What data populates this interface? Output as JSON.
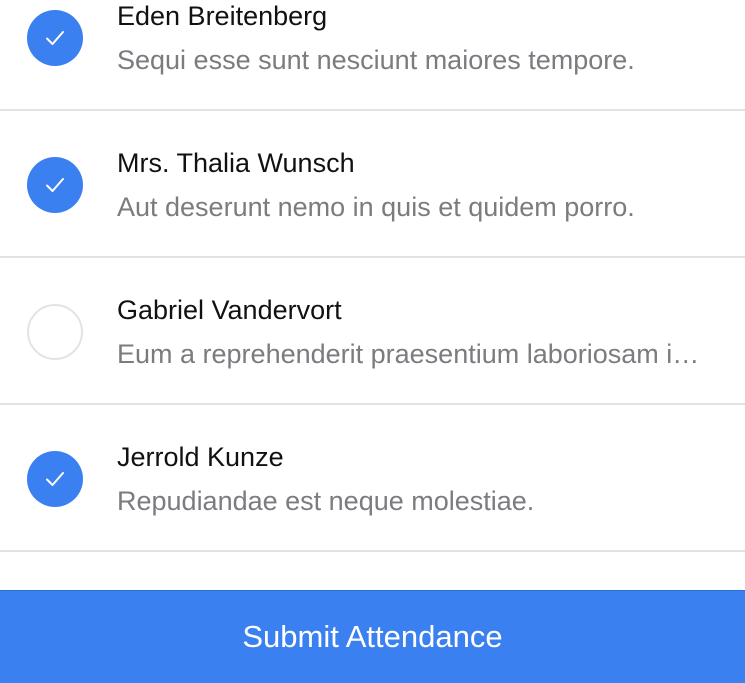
{
  "attendees": [
    {
      "name": "Eden Breitenberg",
      "note": "Sequi esse sunt nesciunt maiores tempore.",
      "checked": true
    },
    {
      "name": "Mrs. Thalia Wunsch",
      "note": "Aut deserunt nemo in quis et quidem porro.",
      "checked": true
    },
    {
      "name": "Gabriel Vandervort",
      "note": "Eum a reprehenderit praesentium laboriosam in ducimus.",
      "checked": false
    },
    {
      "name": "Jerrold Kunze",
      "note": "Repudiandae est neque molestiae.",
      "checked": true
    }
  ],
  "submit_label": "Submit Attendance",
  "colors": {
    "accent": "#3a80f0",
    "check_mark": "#ffffff",
    "unchecked_border": "#e3e3e6"
  },
  "icons": {
    "checked": "checkmark-icon",
    "unchecked": "empty-circle-icon"
  }
}
